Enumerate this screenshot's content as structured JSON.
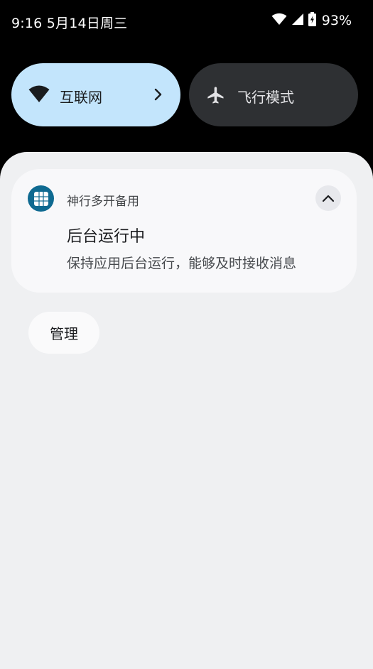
{
  "status_bar": {
    "time_date": "9:16 5月14日周三",
    "battery_percent": "93%",
    "icons": [
      "wifi-icon",
      "cellular-signal-icon",
      "battery-charging-icon"
    ]
  },
  "quick_settings": {
    "internet": {
      "label": "互联网",
      "icon": "wifi-icon",
      "active": true
    },
    "airplane": {
      "label": "飞行模式",
      "icon": "airplane-icon",
      "active": false
    }
  },
  "notification": {
    "app_name": "神行多开备用",
    "app_icon": "grid-app-icon",
    "title": "后台运行中",
    "body": "保持应用后台运行，能够及时接收消息",
    "expand_icon": "chevron-up-icon"
  },
  "manage_button": {
    "label": "管理"
  },
  "colors": {
    "internet_tile": "#c3e5fc",
    "airplane_tile": "#2e3033",
    "shade_bg": "#eff0f2",
    "card_bg": "#f8f8fa",
    "app_icon_bg": "#0f6a91"
  }
}
